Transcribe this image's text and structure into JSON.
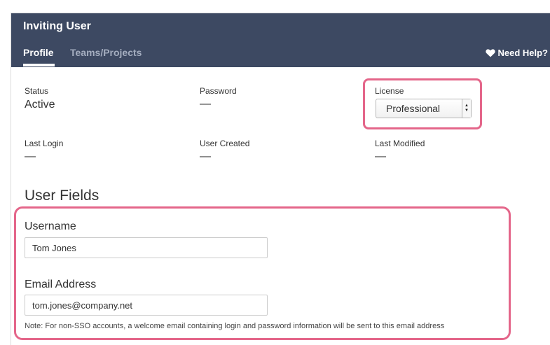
{
  "header": {
    "title": "Inviting User",
    "tabs": [
      {
        "label": "Profile",
        "active": true
      },
      {
        "label": "Teams/Projects",
        "active": false
      }
    ],
    "help_label": "Need Help?",
    "help_icon": "heart-icon",
    "background_color": "#3d4962"
  },
  "summary": {
    "status": {
      "label": "Status",
      "value": "Active"
    },
    "password": {
      "label": "Password",
      "value": "—"
    },
    "license": {
      "label": "License",
      "selected": "Professional"
    },
    "last_login": {
      "label": "Last Login",
      "value": "—"
    },
    "user_created": {
      "label": "User Created",
      "value": "—"
    },
    "last_modified": {
      "label": "Last Modified",
      "value": "—"
    }
  },
  "user_fields": {
    "title": "User Fields",
    "username": {
      "label": "Username",
      "value": "Tom Jones"
    },
    "email": {
      "label": "Email Address",
      "value": "tom.jones@company.net"
    },
    "note": "Note: For non-SSO accounts, a welcome email containing login and password information will be sent to this email address"
  },
  "highlight_color": "#e4668a"
}
